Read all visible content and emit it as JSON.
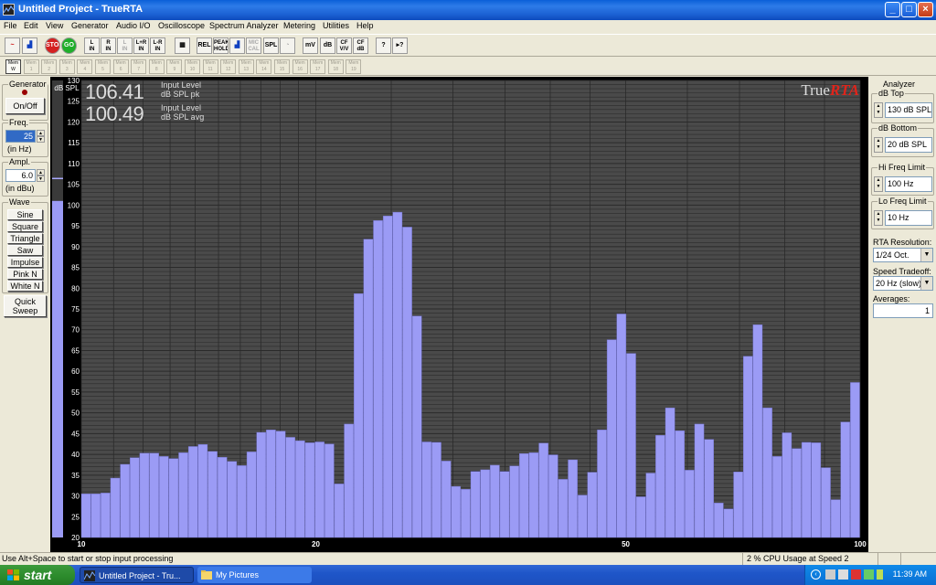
{
  "window": {
    "title": "Untitled Project - TrueRTA",
    "minimize": "_",
    "maximize": "□",
    "close": "×"
  },
  "menu": [
    "File",
    "Edit",
    "View",
    "Generator",
    "Audio I/O",
    "Oscilloscope",
    "Spectrum Analyzer",
    "Metering",
    "Utilities",
    "Help"
  ],
  "toolbar": {
    "buttons": [
      {
        "name": "sine-wave-view-icon",
        "l1": "~",
        "l2": ""
      },
      {
        "name": "bar-view-icon",
        "l1": "▟",
        "l2": ""
      },
      {
        "name": "stop-button",
        "l1": "STOP",
        "l2": ""
      },
      {
        "name": "go-button",
        "l1": "GO",
        "l2": ""
      },
      {
        "name": "left-input-button",
        "l1": "L",
        "l2": "IN"
      },
      {
        "name": "right-input-button",
        "l1": "R",
        "l2": "IN"
      },
      {
        "name": "left-in-dim-button",
        "l1": "L",
        "l2": "IN"
      },
      {
        "name": "l-plus-r-input-button",
        "l1": "L+R",
        "l2": "IN"
      },
      {
        "name": "l-minus-r-input-button",
        "l1": "L-R",
        "l2": "IN"
      },
      {
        "name": "grid-button",
        "l1": "▦",
        "l2": ""
      },
      {
        "name": "rel-button",
        "l1": "REL",
        "l2": ""
      },
      {
        "name": "peak-hold-button",
        "l1": "PEAK",
        "l2": "HOLD"
      },
      {
        "name": "bars-button",
        "l1": "▟",
        "l2": ""
      },
      {
        "name": "mic-cal-button",
        "l1": "MIC",
        "l2": "CAL"
      },
      {
        "name": "spl-button",
        "l1": "SPL",
        "l2": ""
      },
      {
        "name": "gauge-button",
        "l1": "◔",
        "l2": ""
      },
      {
        "name": "mv-button",
        "l1": "mV",
        "l2": ""
      },
      {
        "name": "db-button",
        "l1": "dB",
        "l2": ""
      },
      {
        "name": "cf-vv-button",
        "l1": "CF",
        "l2": "V/V"
      },
      {
        "name": "cf-db-button",
        "l1": "CF",
        "l2": "dB"
      },
      {
        "name": "help-button",
        "l1": "?",
        "l2": ""
      },
      {
        "name": "context-help-button",
        "l1": "▸?",
        "l2": ""
      }
    ],
    "memories": [
      {
        "l1": "Mem",
        "l2": "W"
      },
      {
        "l1": "Mem",
        "l2": "1"
      },
      {
        "l1": "Mem",
        "l2": "2"
      },
      {
        "l1": "Mem",
        "l2": "3"
      },
      {
        "l1": "Mem",
        "l2": "4"
      },
      {
        "l1": "Mem",
        "l2": "5"
      },
      {
        "l1": "Mem",
        "l2": "6"
      },
      {
        "l1": "Mem",
        "l2": "7"
      },
      {
        "l1": "Mem",
        "l2": "8"
      },
      {
        "l1": "Mem",
        "l2": "9"
      },
      {
        "l1": "Mem",
        "l2": "10"
      },
      {
        "l1": "Mem",
        "l2": "11"
      },
      {
        "l1": "Mem",
        "l2": "12"
      },
      {
        "l1": "Mem",
        "l2": "13"
      },
      {
        "l1": "Mem",
        "l2": "14"
      },
      {
        "l1": "Mem",
        "l2": "15"
      },
      {
        "l1": "Mem",
        "l2": "16"
      },
      {
        "l1": "Mem",
        "l2": "17"
      },
      {
        "l1": "Mem",
        "l2": "18"
      },
      {
        "l1": "Mem",
        "l2": "19"
      }
    ]
  },
  "generator": {
    "title": "Generator",
    "onoff": "On/Off",
    "freq_label": "Freq.",
    "freq_value": "25",
    "freq_unit": "(in Hz)",
    "ampl_label": "Ampl.",
    "ampl_value": "6.0",
    "ampl_unit": "(in dBu)",
    "wave_label": "Wave",
    "waves": [
      "Sine",
      "Square",
      "Triangle",
      "Saw",
      "Impulse",
      "Pink N",
      "White N"
    ],
    "sweep_l1": "Quick",
    "sweep_l2": "Sweep"
  },
  "readout": {
    "pk_value": "106.41",
    "pk_l1": "Input Level",
    "pk_l2": "dB SPL pk",
    "avg_value": "100.49",
    "avg_l1": "Input Level",
    "avg_l2": "dB SPL avg"
  },
  "brand": {
    "a": "True",
    "b": "RTA"
  },
  "analyzer": {
    "title": "Analyzer",
    "dbtop_label": "dB Top",
    "dbtop_value": "130 dB SPL",
    "dbbottom_label": "dB Bottom",
    "dbbottom_value": "20 dB SPL",
    "hifreq_label": "Hi Freq Limit",
    "hifreq_value": "100 Hz",
    "lofreq_label": "Lo Freq Limit",
    "lofreq_value": "10 Hz",
    "res_label": "RTA Resolution:",
    "res_value": "1/24 Oct.",
    "tradeoff_label": "Speed Tradeoff:",
    "tradeoff_value": "20 Hz (slow)",
    "avg_label": "Averages:",
    "avg_value": "1"
  },
  "status": {
    "left": "Use Alt+Space to start or stop input processing",
    "right": "2 % CPU Usage at Speed 2"
  },
  "taskbar": {
    "start": "start",
    "task1": "Untitled Project - Tru...",
    "task2": "My Pictures",
    "clock": "11:39 AM"
  },
  "colors": {
    "bar": "#9b9bf5",
    "bar_edge": "#6e6ec8",
    "plot_bg": "#4a4a4a",
    "grid": "#2a2a2a",
    "brand_red": "#e0241b"
  },
  "chart_data": {
    "type": "bar",
    "ylabel": "dB SPL",
    "xscale": "log",
    "xlim": [
      10,
      100
    ],
    "ylim": [
      20,
      130
    ],
    "yticks": [
      20,
      25,
      30,
      35,
      40,
      45,
      50,
      55,
      60,
      65,
      70,
      75,
      80,
      85,
      90,
      95,
      100,
      105,
      110,
      115,
      120,
      125,
      130
    ],
    "xticks": [
      {
        "v": 10,
        "label": "10"
      },
      {
        "v": 20,
        "label": "20"
      },
      {
        "v": 50,
        "label": "50"
      },
      {
        "v": 100,
        "label": "100"
      }
    ],
    "meter_level_db": 101,
    "values": [
      30.5,
      30.5,
      30.7,
      34.3,
      37.6,
      39.2,
      40.3,
      40.3,
      39.5,
      39.0,
      40.4,
      41.9,
      42.4,
      40.7,
      39.3,
      38.3,
      37.3,
      40.6,
      45.3,
      45.9,
      45.6,
      44.1,
      43.3,
      42.8,
      43.0,
      42.5,
      32.9,
      47.3,
      78.7,
      91.8,
      96.3,
      97.4,
      98.3,
      94.7,
      73.3,
      43.0,
      42.9,
      38.4,
      32.3,
      31.6,
      35.9,
      36.3,
      37.4,
      35.9,
      37.2,
      40.2,
      40.4,
      42.7,
      39.9,
      34.0,
      38.7,
      30.2,
      35.7,
      45.9,
      67.6,
      73.8,
      64.3,
      29.8,
      35.5,
      44.6,
      51.2,
      45.7,
      36.2,
      47.3,
      43.6,
      28.3,
      26.9,
      35.8,
      63.6,
      71.2,
      51.2,
      39.5,
      45.2,
      41.4,
      42.9,
      42.8,
      36.8,
      29.1,
      47.8,
      57.3
    ]
  }
}
